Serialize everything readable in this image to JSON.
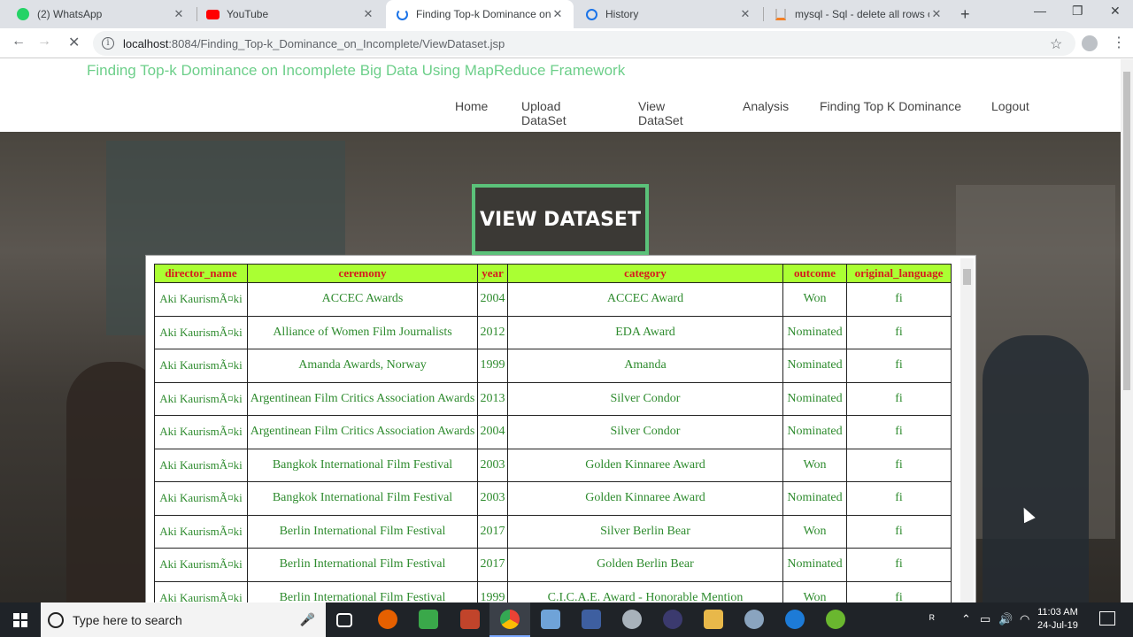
{
  "browser": {
    "tabs": [
      {
        "label": "(2) WhatsApp",
        "icon": "whatsapp-icon",
        "active": false
      },
      {
        "label": "YouTube",
        "icon": "youtube-icon",
        "active": false
      },
      {
        "label": "Finding Top-k Dominance on In",
        "icon": "loading-icon",
        "active": true
      },
      {
        "label": "History",
        "icon": "history-icon",
        "active": false
      },
      {
        "label": "mysql - Sql - delete all rows of",
        "icon": "stackoverflow-icon",
        "active": false
      }
    ],
    "close_glyph": "✕",
    "new_tab": "+",
    "url_host": "localhost",
    "url_path": ":8084/Finding_Top-k_Dominance_on_Incomplete/ViewDataset.jsp"
  },
  "site": {
    "title": "Finding Top-k Dominance on Incomplete Big Data Using MapReduce Framework",
    "menu": [
      "Home",
      "Upload DataSet",
      "View DataSet",
      "Analysis",
      "Finding Top K Dominance",
      "Logout"
    ],
    "heading": "VIEW DATASET"
  },
  "table": {
    "headers": [
      "director_name",
      "ceremony",
      "year",
      "category",
      "outcome",
      "original_language"
    ],
    "rows": [
      [
        "Aki KaurismÃ¤ki",
        "ACCEC Awards",
        "2004",
        "ACCEC Award",
        "Won",
        "fi"
      ],
      [
        "Aki KaurismÃ¤ki",
        "Alliance of Women Film Journalists",
        "2012",
        "EDA Award",
        "Nominated",
        "fi"
      ],
      [
        "Aki KaurismÃ¤ki",
        "Amanda Awards, Norway",
        "1999",
        "Amanda",
        "Nominated",
        "fi"
      ],
      [
        "Aki KaurismÃ¤ki",
        "Argentinean Film Critics Association Awards",
        "2013",
        "Silver Condor",
        "Nominated",
        "fi"
      ],
      [
        "Aki KaurismÃ¤ki",
        "Argentinean Film Critics Association Awards",
        "2004",
        "Silver Condor",
        "Nominated",
        "fi"
      ],
      [
        "Aki KaurismÃ¤ki",
        "Bangkok International Film Festival",
        "2003",
        "Golden Kinnaree Award",
        "Won",
        "fi"
      ],
      [
        "Aki KaurismÃ¤ki",
        "Bangkok International Film Festival",
        "2003",
        "Golden Kinnaree Award",
        "Nominated",
        "fi"
      ],
      [
        "Aki KaurismÃ¤ki",
        "Berlin International Film Festival",
        "2017",
        "Silver Berlin Bear",
        "Won",
        "fi"
      ],
      [
        "Aki KaurismÃ¤ki",
        "Berlin International Film Festival",
        "2017",
        "Golden Berlin Bear",
        "Nominated",
        "fi"
      ],
      [
        "Aki KaurismÃ¤ki",
        "Berlin International Film Festival",
        "1999",
        "C.I.C.A.E. Award - Honorable Mention",
        "Won",
        "fi"
      ]
    ]
  },
  "taskbar": {
    "search_placeholder": "Type here to search",
    "time": "11:03 AM",
    "date": "24-Jul-19"
  },
  "colors": {
    "title_green": "#6dcf8a",
    "header_bg": "#aaff33",
    "header_text": "#d51d1d",
    "cell_text": "#2e8b2e"
  }
}
